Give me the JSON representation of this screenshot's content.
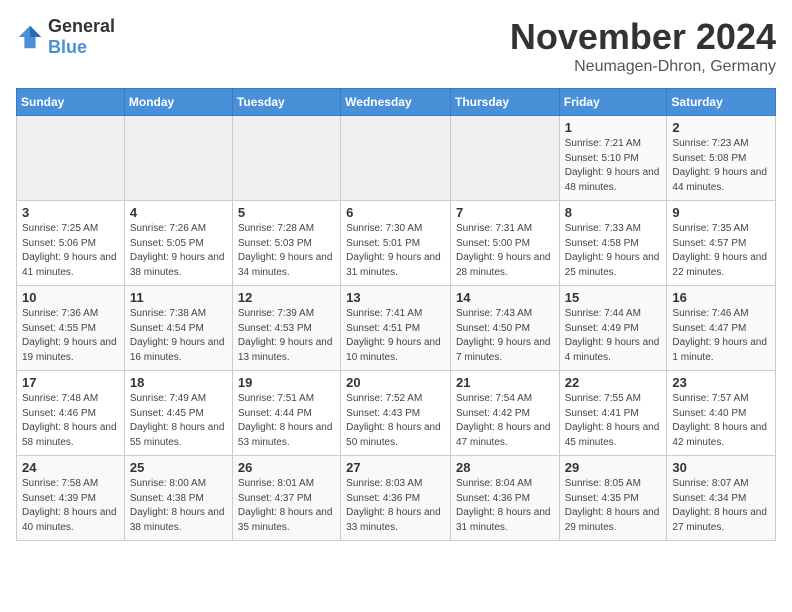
{
  "logo": {
    "text_general": "General",
    "text_blue": "Blue"
  },
  "header": {
    "month": "November 2024",
    "location": "Neumagen-Dhron, Germany"
  },
  "weekdays": [
    "Sunday",
    "Monday",
    "Tuesday",
    "Wednesday",
    "Thursday",
    "Friday",
    "Saturday"
  ],
  "rows": [
    [
      {
        "day": "",
        "info": ""
      },
      {
        "day": "",
        "info": ""
      },
      {
        "day": "",
        "info": ""
      },
      {
        "day": "",
        "info": ""
      },
      {
        "day": "",
        "info": ""
      },
      {
        "day": "1",
        "info": "Sunrise: 7:21 AM\nSunset: 5:10 PM\nDaylight: 9 hours and 48 minutes."
      },
      {
        "day": "2",
        "info": "Sunrise: 7:23 AM\nSunset: 5:08 PM\nDaylight: 9 hours and 44 minutes."
      }
    ],
    [
      {
        "day": "3",
        "info": "Sunrise: 7:25 AM\nSunset: 5:06 PM\nDaylight: 9 hours and 41 minutes."
      },
      {
        "day": "4",
        "info": "Sunrise: 7:26 AM\nSunset: 5:05 PM\nDaylight: 9 hours and 38 minutes."
      },
      {
        "day": "5",
        "info": "Sunrise: 7:28 AM\nSunset: 5:03 PM\nDaylight: 9 hours and 34 minutes."
      },
      {
        "day": "6",
        "info": "Sunrise: 7:30 AM\nSunset: 5:01 PM\nDaylight: 9 hours and 31 minutes."
      },
      {
        "day": "7",
        "info": "Sunrise: 7:31 AM\nSunset: 5:00 PM\nDaylight: 9 hours and 28 minutes."
      },
      {
        "day": "8",
        "info": "Sunrise: 7:33 AM\nSunset: 4:58 PM\nDaylight: 9 hours and 25 minutes."
      },
      {
        "day": "9",
        "info": "Sunrise: 7:35 AM\nSunset: 4:57 PM\nDaylight: 9 hours and 22 minutes."
      }
    ],
    [
      {
        "day": "10",
        "info": "Sunrise: 7:36 AM\nSunset: 4:55 PM\nDaylight: 9 hours and 19 minutes."
      },
      {
        "day": "11",
        "info": "Sunrise: 7:38 AM\nSunset: 4:54 PM\nDaylight: 9 hours and 16 minutes."
      },
      {
        "day": "12",
        "info": "Sunrise: 7:39 AM\nSunset: 4:53 PM\nDaylight: 9 hours and 13 minutes."
      },
      {
        "day": "13",
        "info": "Sunrise: 7:41 AM\nSunset: 4:51 PM\nDaylight: 9 hours and 10 minutes."
      },
      {
        "day": "14",
        "info": "Sunrise: 7:43 AM\nSunset: 4:50 PM\nDaylight: 9 hours and 7 minutes."
      },
      {
        "day": "15",
        "info": "Sunrise: 7:44 AM\nSunset: 4:49 PM\nDaylight: 9 hours and 4 minutes."
      },
      {
        "day": "16",
        "info": "Sunrise: 7:46 AM\nSunset: 4:47 PM\nDaylight: 9 hours and 1 minute."
      }
    ],
    [
      {
        "day": "17",
        "info": "Sunrise: 7:48 AM\nSunset: 4:46 PM\nDaylight: 8 hours and 58 minutes."
      },
      {
        "day": "18",
        "info": "Sunrise: 7:49 AM\nSunset: 4:45 PM\nDaylight: 8 hours and 55 minutes."
      },
      {
        "day": "19",
        "info": "Sunrise: 7:51 AM\nSunset: 4:44 PM\nDaylight: 8 hours and 53 minutes."
      },
      {
        "day": "20",
        "info": "Sunrise: 7:52 AM\nSunset: 4:43 PM\nDaylight: 8 hours and 50 minutes."
      },
      {
        "day": "21",
        "info": "Sunrise: 7:54 AM\nSunset: 4:42 PM\nDaylight: 8 hours and 47 minutes."
      },
      {
        "day": "22",
        "info": "Sunrise: 7:55 AM\nSunset: 4:41 PM\nDaylight: 8 hours and 45 minutes."
      },
      {
        "day": "23",
        "info": "Sunrise: 7:57 AM\nSunset: 4:40 PM\nDaylight: 8 hours and 42 minutes."
      }
    ],
    [
      {
        "day": "24",
        "info": "Sunrise: 7:58 AM\nSunset: 4:39 PM\nDaylight: 8 hours and 40 minutes."
      },
      {
        "day": "25",
        "info": "Sunrise: 8:00 AM\nSunset: 4:38 PM\nDaylight: 8 hours and 38 minutes."
      },
      {
        "day": "26",
        "info": "Sunrise: 8:01 AM\nSunset: 4:37 PM\nDaylight: 8 hours and 35 minutes."
      },
      {
        "day": "27",
        "info": "Sunrise: 8:03 AM\nSunset: 4:36 PM\nDaylight: 8 hours and 33 minutes."
      },
      {
        "day": "28",
        "info": "Sunrise: 8:04 AM\nSunset: 4:36 PM\nDaylight: 8 hours and 31 minutes."
      },
      {
        "day": "29",
        "info": "Sunrise: 8:05 AM\nSunset: 4:35 PM\nDaylight: 8 hours and 29 minutes."
      },
      {
        "day": "30",
        "info": "Sunrise: 8:07 AM\nSunset: 4:34 PM\nDaylight: 8 hours and 27 minutes."
      }
    ]
  ]
}
